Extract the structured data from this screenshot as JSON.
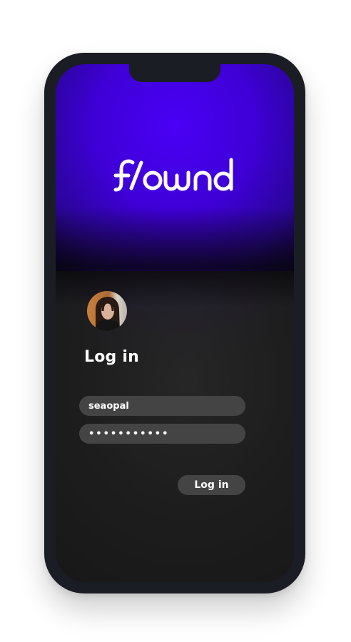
{
  "app": {
    "logo_text": "flownd"
  },
  "login": {
    "title": "Log in",
    "username_value": "seaopal",
    "password_value": "•••••••••••",
    "submit_label": "Log in"
  },
  "colors": {
    "brand_purple": "#4a00f5",
    "field_bg": "#444444",
    "text": "#ffffff",
    "device_frame": "#1b1d24"
  }
}
